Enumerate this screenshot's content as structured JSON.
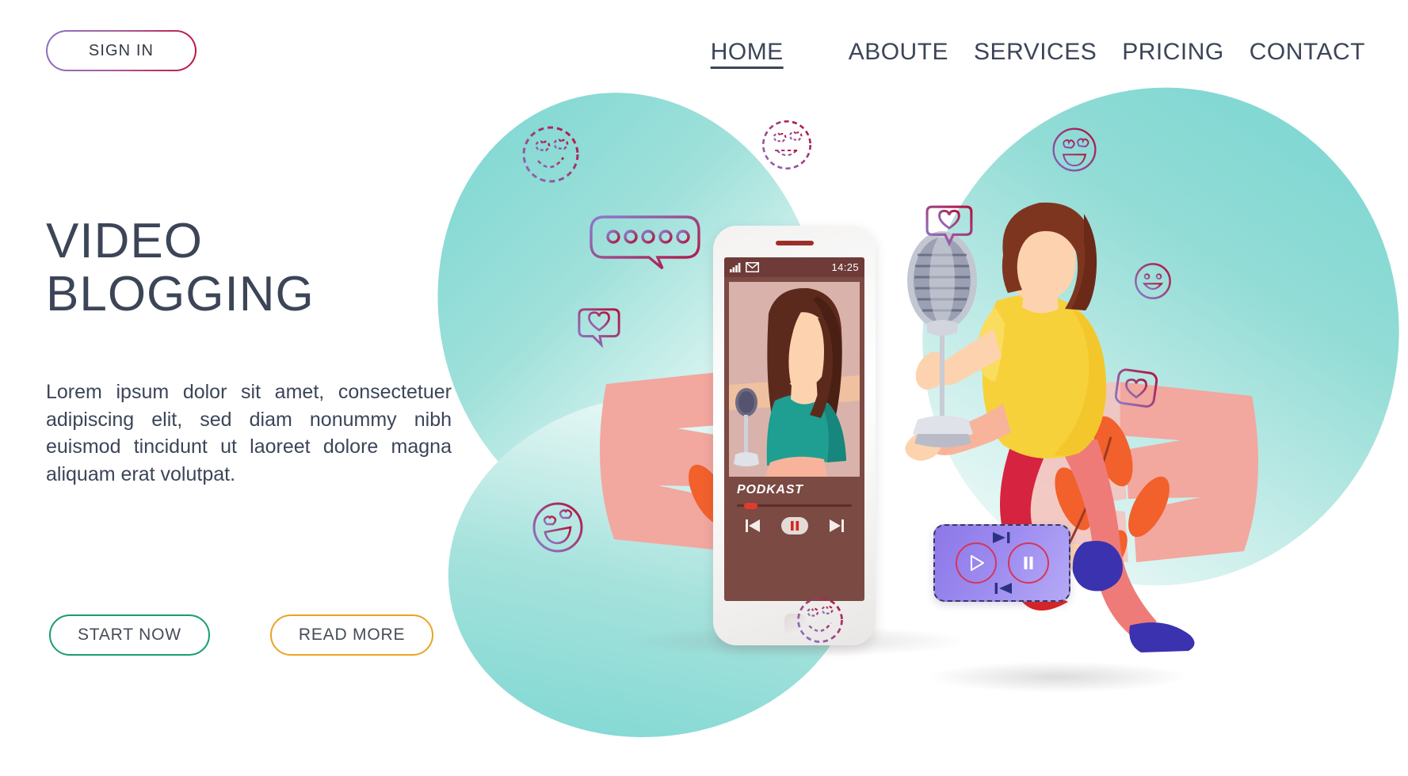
{
  "header": {
    "signin_label": "SIGN IN",
    "nav": [
      {
        "label": "HOME",
        "active": true
      },
      {
        "label": "ABOUTE",
        "active": false
      },
      {
        "label": "SERVICES",
        "active": false
      },
      {
        "label": "PRICING",
        "active": false
      },
      {
        "label": "CONTACT",
        "active": false
      }
    ]
  },
  "hero": {
    "title_line1": "VIDEO",
    "title_line2": "BLOGGING",
    "body": "Lorem ipsum dolor sit amet, consectetuer adipiscing elit, sed diam nonummy nibh euismod tincidunt ut laoreet dolore magna aliquam erat volutpat.",
    "cta_primary": "START NOW",
    "cta_secondary": "READ MORE"
  },
  "phone": {
    "status_time": "14:25",
    "player_title": "PODKAST",
    "progress_percent": 7,
    "controls": [
      "previous-track",
      "pause",
      "next-track"
    ]
  },
  "player_card": {
    "buttons": [
      "play",
      "pause"
    ],
    "skip_icons": [
      "next-track",
      "previous-track"
    ]
  },
  "illustration": {
    "scene": "woman holding vintage microphone beside smartphone",
    "floating_icons": [
      "heart-eyes-emoji",
      "heart-eyes-emoji",
      "heart-eyes-emoji",
      "chat-bubble-dots-icon",
      "heart-badge-icon",
      "heart-badge-icon",
      "heart-badge-icon",
      "smiley-emoji",
      "smiley-emoji",
      "smiley-emoji"
    ]
  },
  "colors": {
    "text_navy": "#3c4558",
    "teal_blob": "#7ad6d2",
    "accent_green": "#189b76",
    "accent_orange": "#e8a524",
    "accent_crimson": "#c2123c",
    "accent_purple": "#8a6fc4",
    "shirt_yellow": "#f7d13a",
    "pants_red": "#d6233f",
    "shoe_blue": "#3b32b0",
    "leaf_salmon": "#f1a79e",
    "leaf_orange": "#f2602c",
    "phone_screen": "#7a4a43"
  }
}
